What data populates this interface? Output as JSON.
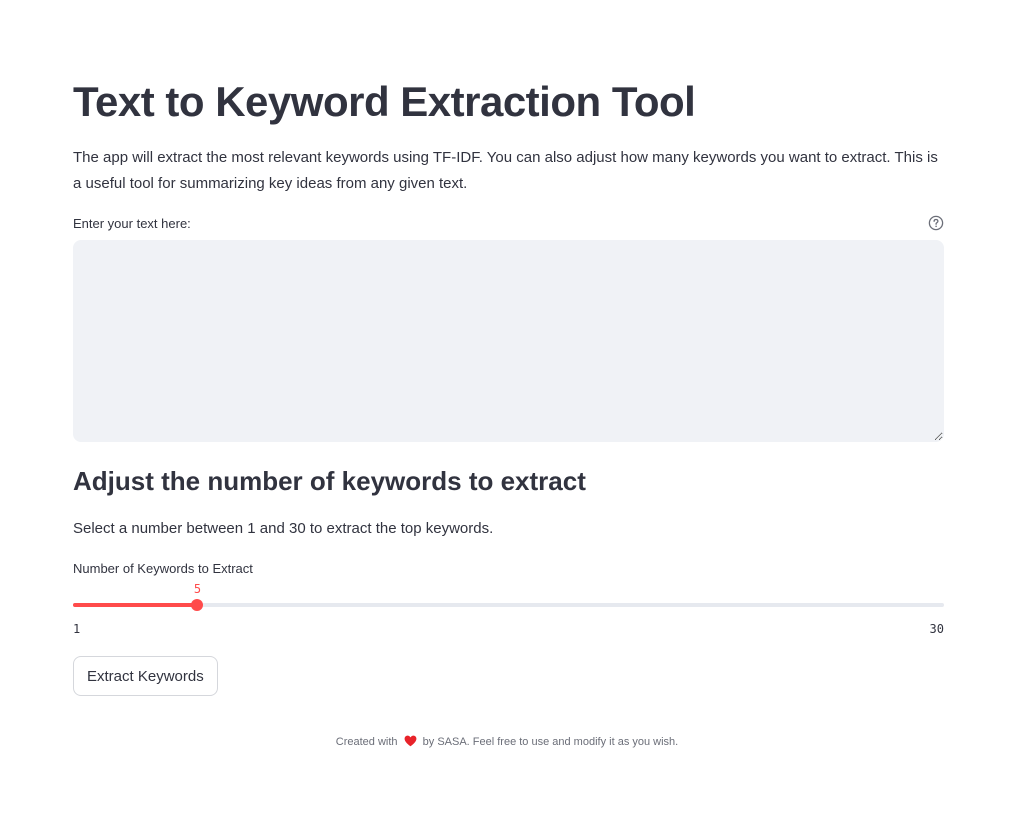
{
  "header": {
    "title": "Text to Keyword Extraction Tool",
    "description": "The app will extract the most relevant keywords using TF-IDF. You can also adjust how many keywords you want to extract. This is a useful tool for summarizing key ideas from any given text."
  },
  "text_input": {
    "label": "Enter your text here:",
    "value": "",
    "placeholder": "",
    "help_icon": "question-circle-icon"
  },
  "keyword_section": {
    "heading": "Adjust the number of keywords to extract",
    "description": "Select a number between 1 and 30 to extract the top keywords."
  },
  "slider": {
    "label": "Number of Keywords to Extract",
    "min": 1,
    "max": 30,
    "value": 5,
    "min_label": "1",
    "max_label": "30",
    "value_label": "5"
  },
  "actions": {
    "extract_label": "Extract Keywords"
  },
  "footer": {
    "prefix": "Created with",
    "suffix": "by SASA. Feel free to use and modify it as you wish.",
    "icon": "heart-icon"
  },
  "colors": {
    "accent": "#ff4b4b",
    "text": "#31333f",
    "input_bg": "#f0f2f6",
    "track": "#e6e9ef",
    "muted": "#6b6e78"
  }
}
